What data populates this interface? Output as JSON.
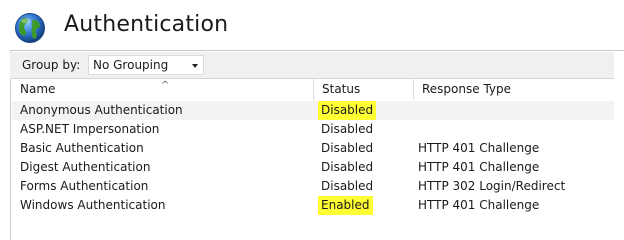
{
  "page": {
    "title": "Authentication"
  },
  "toolbar": {
    "group_by_label": "Group by:",
    "group_by_value": "No Grouping"
  },
  "table": {
    "columns": {
      "name": "Name",
      "status": "Status",
      "response": "Response Type"
    },
    "rows": [
      {
        "name": "Anonymous Authentication",
        "status": "Disabled",
        "response": "",
        "highlighted": true
      },
      {
        "name": "ASP.NET Impersonation",
        "status": "Disabled",
        "response": "",
        "highlighted": false
      },
      {
        "name": "Basic Authentication",
        "status": "Disabled",
        "response": "HTTP 401 Challenge",
        "highlighted": false
      },
      {
        "name": "Digest Authentication",
        "status": "Disabled",
        "response": "HTTP 401 Challenge",
        "highlighted": false
      },
      {
        "name": "Forms Authentication",
        "status": "Disabled",
        "response": "HTTP 302 Login/Redirect",
        "highlighted": false
      },
      {
        "name": "Windows Authentication",
        "status": "Enabled",
        "response": "HTTP 401 Challenge",
        "highlighted": true
      }
    ]
  },
  "colors": {
    "highlight": "#ffff33",
    "toolbar_bg": "#f0f0f0",
    "globe_blue": "#2a6fc9",
    "globe_green": "#3f9a2e"
  },
  "icons": {
    "page_icon": "globe-icon",
    "sort": "sort-ascending-icon",
    "dropdown": "chevron-down-icon"
  }
}
